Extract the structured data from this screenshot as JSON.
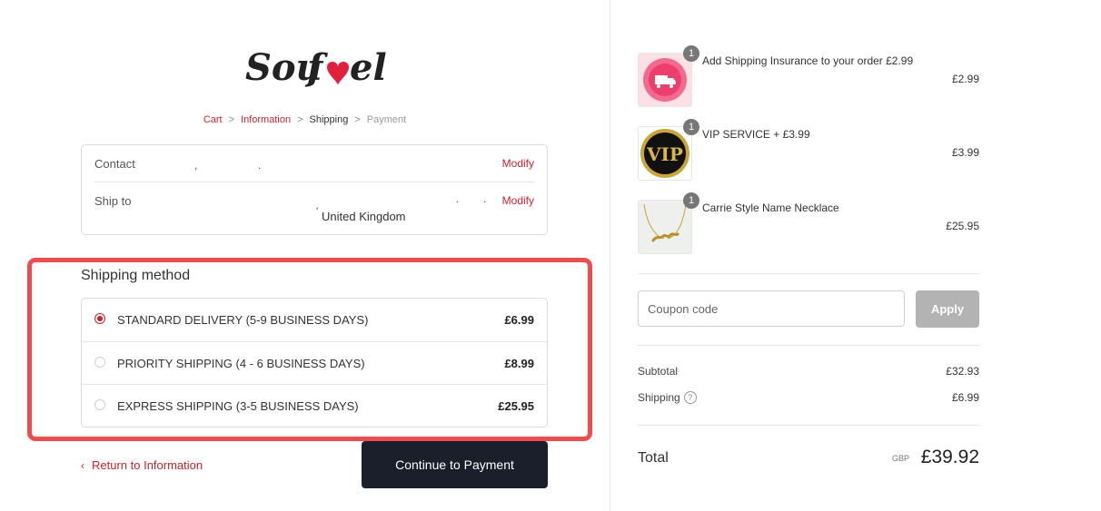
{
  "brand": {
    "logo_text": "Soufeel"
  },
  "breadcrumb": {
    "items": [
      {
        "label": "Cart",
        "state": "link"
      },
      {
        "label": "Information",
        "state": "link"
      },
      {
        "label": "Shipping",
        "state": "current"
      },
      {
        "label": "Payment",
        "state": "upcoming"
      }
    ],
    "separator": ">"
  },
  "info": {
    "contact_label": "Contact",
    "ship_to_label": "Ship to",
    "ship_to_value": "United Kingdom",
    "modify_label": "Modify"
  },
  "shipping": {
    "title": "Shipping method",
    "options": [
      {
        "name": "STANDARD DELIVERY (5-9 BUSINESS DAYS)",
        "price": "£6.99",
        "selected": true
      },
      {
        "name": "PRIORITY SHIPPING (4 - 6 BUSINESS DAYS)",
        "price": "£8.99",
        "selected": false
      },
      {
        "name": "EXPRESS SHIPPING (3-5 BUSINESS DAYS)",
        "price": "£25.95",
        "selected": false
      }
    ]
  },
  "nav": {
    "return_label": "Return to Information",
    "continue_label": "Continue to Payment"
  },
  "order": {
    "items": [
      {
        "name": "Add Shipping Insurance to your order £2.99",
        "price": "£2.99",
        "qty": "1",
        "icon": "shipping-insurance-icon"
      },
      {
        "name": "VIP SERVICE + £3.99",
        "price": "£3.99",
        "qty": "1",
        "icon": "vip-badge-icon"
      },
      {
        "name": "Carrie Style Name Necklace",
        "price": "£25.95",
        "qty": "1",
        "icon": "necklace-image"
      }
    ],
    "coupon_placeholder": "Coupon code",
    "apply_label": "Apply",
    "subtotal_label": "Subtotal",
    "subtotal_value": "£32.93",
    "shipping_label": "Shipping",
    "shipping_value": "£6.99",
    "total_label": "Total",
    "currency": "GBP",
    "total_value": "£39.92"
  },
  "colors": {
    "accent": "#c8232c",
    "highlight_border": "#ee4d4d",
    "primary_button": "#1a1f2b",
    "apply_button": "#b3b3b3"
  }
}
